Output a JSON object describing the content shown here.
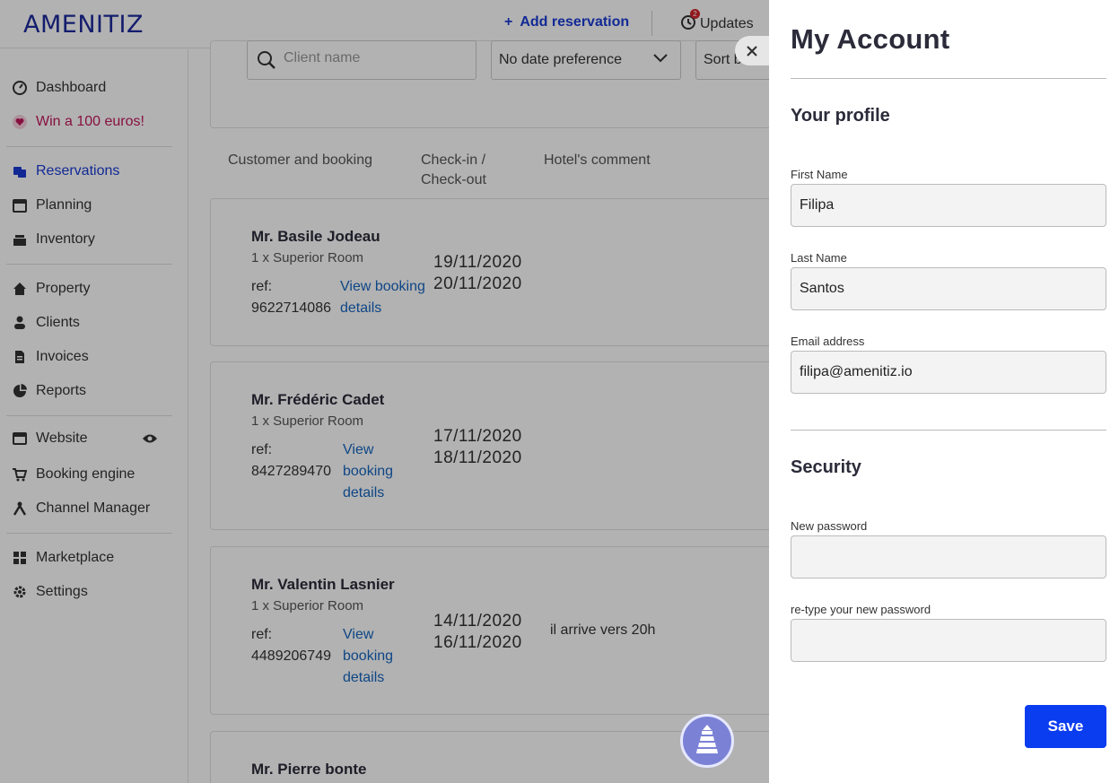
{
  "app": {
    "logo": "AMENITIZ",
    "add_reservation": "Add reservation",
    "updates": "Updates",
    "updates_count": "2"
  },
  "sidebar": {
    "items": [
      {
        "label": "Dashboard",
        "icon": "dashboard-icon"
      },
      {
        "label": "Win a 100 euros!",
        "icon": "heart-icon"
      },
      {
        "label": "Reservations",
        "icon": "reservations-icon"
      },
      {
        "label": "Planning",
        "icon": "calendar-icon"
      },
      {
        "label": "Inventory",
        "icon": "inventory-icon"
      },
      {
        "label": "Property",
        "icon": "home-icon"
      },
      {
        "label": "Clients",
        "icon": "clients-icon"
      },
      {
        "label": "Invoices",
        "icon": "invoice-icon"
      },
      {
        "label": "Reports",
        "icon": "pie-chart-icon"
      },
      {
        "label": "Website",
        "icon": "browser-icon"
      },
      {
        "label": "Booking engine",
        "icon": "cart-icon"
      },
      {
        "label": "Channel Manager",
        "icon": "channel-icon"
      },
      {
        "label": "Marketplace",
        "icon": "grid-icon"
      },
      {
        "label": "Settings",
        "icon": "gear-icon"
      }
    ]
  },
  "filters": {
    "search_placeholder": "Client name",
    "date_preference": "No date preference",
    "sort": "Sort b"
  },
  "columns": {
    "customer": "Customer and booking",
    "checkin": "Check-in /",
    "checkout": "Check-out",
    "comment": "Hotel's comment"
  },
  "reservations": [
    {
      "name": "Mr. Basile Jodeau",
      "room": "1 x Superior Room",
      "ref_label": "ref:",
      "ref": "9622714086",
      "link1": "View booking",
      "link2": "details",
      "link3": "",
      "checkin": "19/11/2020",
      "checkout": "20/11/2020",
      "comment": ""
    },
    {
      "name": "Mr. Frédéric Cadet",
      "room": "1 x Superior Room",
      "ref_label": "ref:",
      "ref": "8427289470",
      "link1": "View",
      "link2": "booking",
      "link3": "details",
      "checkin": "17/11/2020",
      "checkout": "18/11/2020",
      "comment": ""
    },
    {
      "name": "Mr. Valentin Lasnier",
      "room": "1 x Superior Room",
      "ref_label": "ref:",
      "ref": "4489206749",
      "link1": "View",
      "link2": "booking",
      "link3": "details",
      "checkin": "14/11/2020",
      "checkout": "16/11/2020",
      "comment": "il arrive vers 20h"
    },
    {
      "name": "Mr. Pierre bonte"
    }
  ],
  "drawer": {
    "title": "My Account",
    "profile_title": "Your profile",
    "first_name_label": "First Name",
    "first_name": "Filipa",
    "last_name_label": "Last Name",
    "last_name": "Santos",
    "email_label": "Email address",
    "email": "filipa@amenitiz.io",
    "security_title": "Security",
    "new_password_label": "New password",
    "new_password": "",
    "retype_password_label": "re-type your new password",
    "retype_password": "",
    "save": "Save"
  },
  "colors": {
    "brand": "#1e2a9c",
    "accent": "#1a3cd6",
    "save_button": "#0a3cf0",
    "promo": "#c2185b",
    "link": "#1565c0"
  }
}
